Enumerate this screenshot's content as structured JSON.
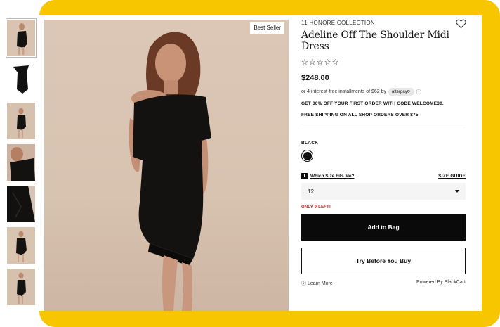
{
  "product": {
    "brand": "11 HONORÉ COLLECTION",
    "title": "Adeline Off The Shoulder Midi Dress",
    "stars": "☆☆☆☆☆",
    "price": "$248.00",
    "installments_text": "or 4 interest-free installments of $62 by",
    "afterpay_label": "afterpay⟳",
    "promo_1": "GET 30% OFF YOUR FIRST ORDER WITH CODE WELCOME30.",
    "promo_2": "FREE SHIPPING ON ALL SHOP ORDERS OVER $75.",
    "color_label": "BLACK",
    "fit_label": "Which Size Fits Me?",
    "size_guide_label": "SIZE GUIDE",
    "selected_size": "12",
    "stock_text": "ONLY 9 LEFT!",
    "add_to_bag_label": "Add to Bag",
    "try_before_label": "Try Before You Buy",
    "learn_more_label": "Learn More",
    "powered_by_label": "Powered By BlackCart"
  },
  "gallery": {
    "badge": "Best Seller",
    "thumbnail_count": 7
  },
  "colors": {
    "frame": "#f7c600",
    "button_dark": "#0a0a0a",
    "stock_red": "#d32020",
    "dress": "#141210",
    "backdrop": "#dcc7b6"
  }
}
